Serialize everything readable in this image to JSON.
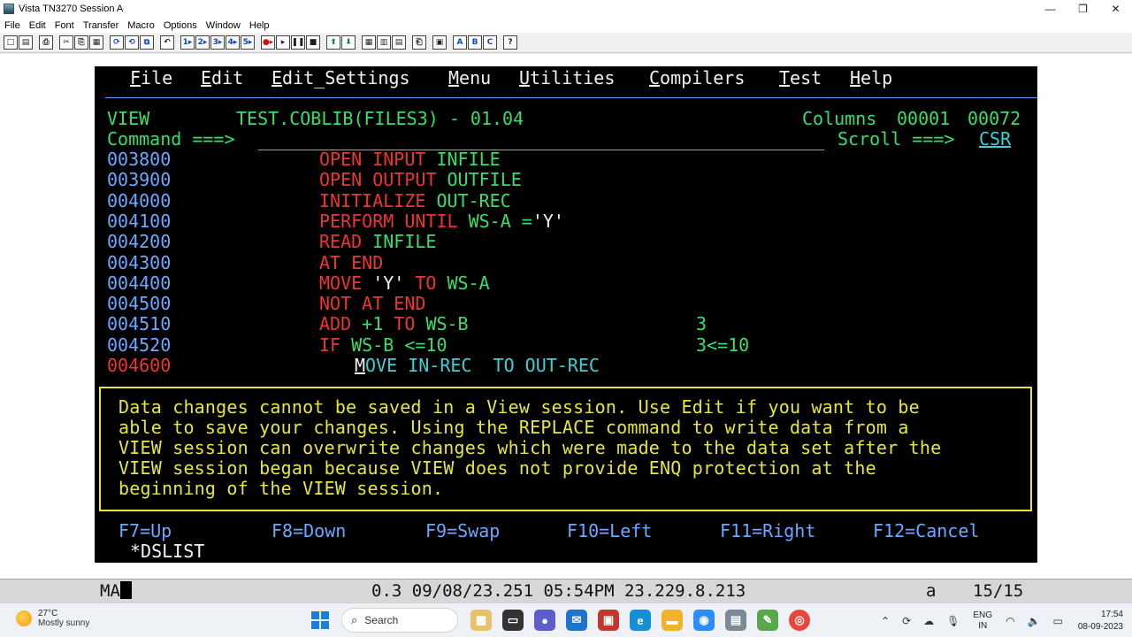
{
  "window": {
    "title": "Vista TN3270 Session A",
    "controls": {
      "minimize": "—",
      "maximize": "❐",
      "close": "✕"
    }
  },
  "menubar": [
    "File",
    "Edit",
    "Font",
    "Transfer",
    "Macro",
    "Options",
    "Window",
    "Help"
  ],
  "toolbar": {
    "groups": [
      [
        "□",
        "▤"
      ],
      [
        "⎙"
      ],
      [
        "✂",
        "⎘",
        "▦"
      ],
      [
        "⟳",
        "⟲",
        "⧉"
      ],
      [
        "↶"
      ],
      [
        "1▸",
        "2▸",
        "3▸",
        "4▸",
        "5▸"
      ],
      [
        "●▸",
        "▸",
        "❚❚",
        "■"
      ],
      [
        "⬆",
        "⬇"
      ],
      [
        "▦",
        "▥",
        "▤"
      ],
      [
        "⎗"
      ],
      [
        "▣"
      ],
      [
        "A",
        "B",
        "C"
      ],
      [
        "?"
      ]
    ]
  },
  "terminal": {
    "ispf_menu": [
      "File",
      "Edit",
      "Edit_Settings",
      "Menu",
      "Utilities",
      "Compilers",
      "Test",
      "Help"
    ],
    "header": {
      "mode": "VIEW",
      "dataset": "TEST.COBLIB(FILES3) - 01.04",
      "columns_label": "Columns",
      "col_from": "00001",
      "col_to": "00072",
      "command_label": "Command ===>",
      "scroll_label": "Scroll ===>",
      "scroll_value": "CSR"
    },
    "lines": [
      {
        "num": "003800",
        "parts": [
          [
            "r",
            "OPEN INPUT "
          ],
          [
            "g",
            "INFILE"
          ]
        ]
      },
      {
        "num": "003900",
        "parts": [
          [
            "r",
            "OPEN OUTPUT "
          ],
          [
            "g",
            "OUTFILE"
          ]
        ]
      },
      {
        "num": "004000",
        "parts": [
          [
            "r",
            "INITIALIZE "
          ],
          [
            "g",
            "OUT-REC"
          ]
        ]
      },
      {
        "num": "004100",
        "parts": [
          [
            "r",
            "PERFORM UNTIL "
          ],
          [
            "g",
            "WS-A ="
          ],
          [
            "w",
            "'Y'"
          ]
        ]
      },
      {
        "num": "004200",
        "parts": [
          [
            "r",
            "READ "
          ],
          [
            "g",
            "INFILE"
          ]
        ]
      },
      {
        "num": "004300",
        "parts": [
          [
            "r",
            "AT END"
          ]
        ]
      },
      {
        "num": "004400",
        "parts": [
          [
            "r",
            "MOVE "
          ],
          [
            "w",
            "'Y'"
          ],
          [
            "r",
            " TO "
          ],
          [
            "g",
            "WS-A"
          ]
        ]
      },
      {
        "num": "004500",
        "parts": [
          [
            "r",
            "NOT AT END"
          ]
        ]
      },
      {
        "num": "004510",
        "parts": [
          [
            "r",
            "ADD "
          ],
          [
            "g",
            "+1"
          ],
          [
            "r",
            " TO "
          ],
          [
            "g",
            "WS-B"
          ]
        ],
        "note": "3"
      },
      {
        "num": "004520",
        "parts": [
          [
            "r",
            "IF "
          ],
          [
            "g",
            "WS-B <=10"
          ]
        ],
        "note": "3<=10"
      },
      {
        "num": "004600",
        "num_color": "r",
        "indent": true,
        "parts": [
          [
            "t",
            "MOVE IN-REC  TO OUT-REC"
          ]
        ]
      }
    ],
    "message": [
      "Data changes cannot be saved in a View session. Use Edit if you want to be",
      "able to save your changes. Using the REPLACE command to write data from a",
      "VIEW session can overwrite changes which were made to the data set after the",
      "VIEW session began because VIEW does not provide ENQ protection at the",
      "beginning of the VIEW session."
    ],
    "function_keys": [
      "F7=Up",
      "F8=Down",
      "F9=Swap",
      "F10=Left",
      "F11=Right",
      "F12=Cancel"
    ],
    "footer_line": "*DSLIST"
  },
  "statusbar": {
    "left": "MA",
    "info": "0.3 09/08/23.251 05:54PM 23.229.8.213",
    "mode": "a",
    "position": "15/15"
  },
  "taskbar": {
    "weather_temp": "27°C",
    "weather_desc": "Mostly sunny",
    "search_label": "Search",
    "language_top": "ENG",
    "language_bottom": "IN",
    "time": "17:54",
    "date": "08-09-2023"
  },
  "colors": {
    "terminal_bg": "#000000",
    "green": "#35e06a",
    "blue": "#6ba8ff",
    "red": "#ef3434",
    "white": "#f2f2f2",
    "turquoise": "#3cd0d8",
    "yellow": "#ffff55"
  }
}
